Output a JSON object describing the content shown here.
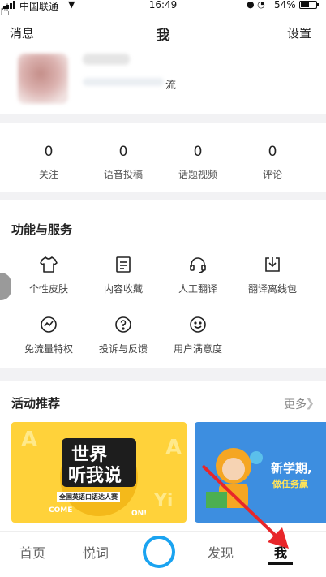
{
  "status_bar": {
    "carrier": "中国联通",
    "time": "16:49",
    "battery": "54%"
  },
  "header": {
    "left": "消息",
    "title": "我",
    "right": "设置"
  },
  "profile": {
    "name_suffix": "流"
  },
  "stats": [
    {
      "value": "0",
      "label": "关注"
    },
    {
      "value": "0",
      "label": "语音投稿"
    },
    {
      "value": "0",
      "label": "话题视频"
    },
    {
      "value": "0",
      "label": "评论"
    }
  ],
  "services": {
    "title": "功能与服务",
    "items": [
      {
        "label": "个性皮肤",
        "icon": "tshirt-icon"
      },
      {
        "label": "内容收藏",
        "icon": "document-icon"
      },
      {
        "label": "人工翻译",
        "icon": "headset-icon"
      },
      {
        "label": "翻译离线包",
        "icon": "download-icon"
      },
      {
        "label": "免流量特权",
        "icon": "activity-icon"
      },
      {
        "label": "投诉与反馈",
        "icon": "question-icon"
      },
      {
        "label": "用户满意度",
        "icon": "smiley-icon"
      }
    ]
  },
  "activities": {
    "title": "活动推荐",
    "more": "更多",
    "banner1": {
      "line1": "世界",
      "line2": "听我说",
      "tagline": "全国英语口语达人赛",
      "badge1": "COME",
      "badge2": "ON!"
    },
    "banner2": {
      "line1": "新学期,",
      "line2": "做任务赢"
    }
  },
  "bottom_nav": {
    "tabs": [
      "首页",
      "悦词",
      "发现",
      "我"
    ],
    "active": "我"
  },
  "colors": {
    "accent": "#1aa3f0",
    "arrow": "#e8262a",
    "banner1": "#ffd23a",
    "banner2": "#3d8ee0"
  }
}
